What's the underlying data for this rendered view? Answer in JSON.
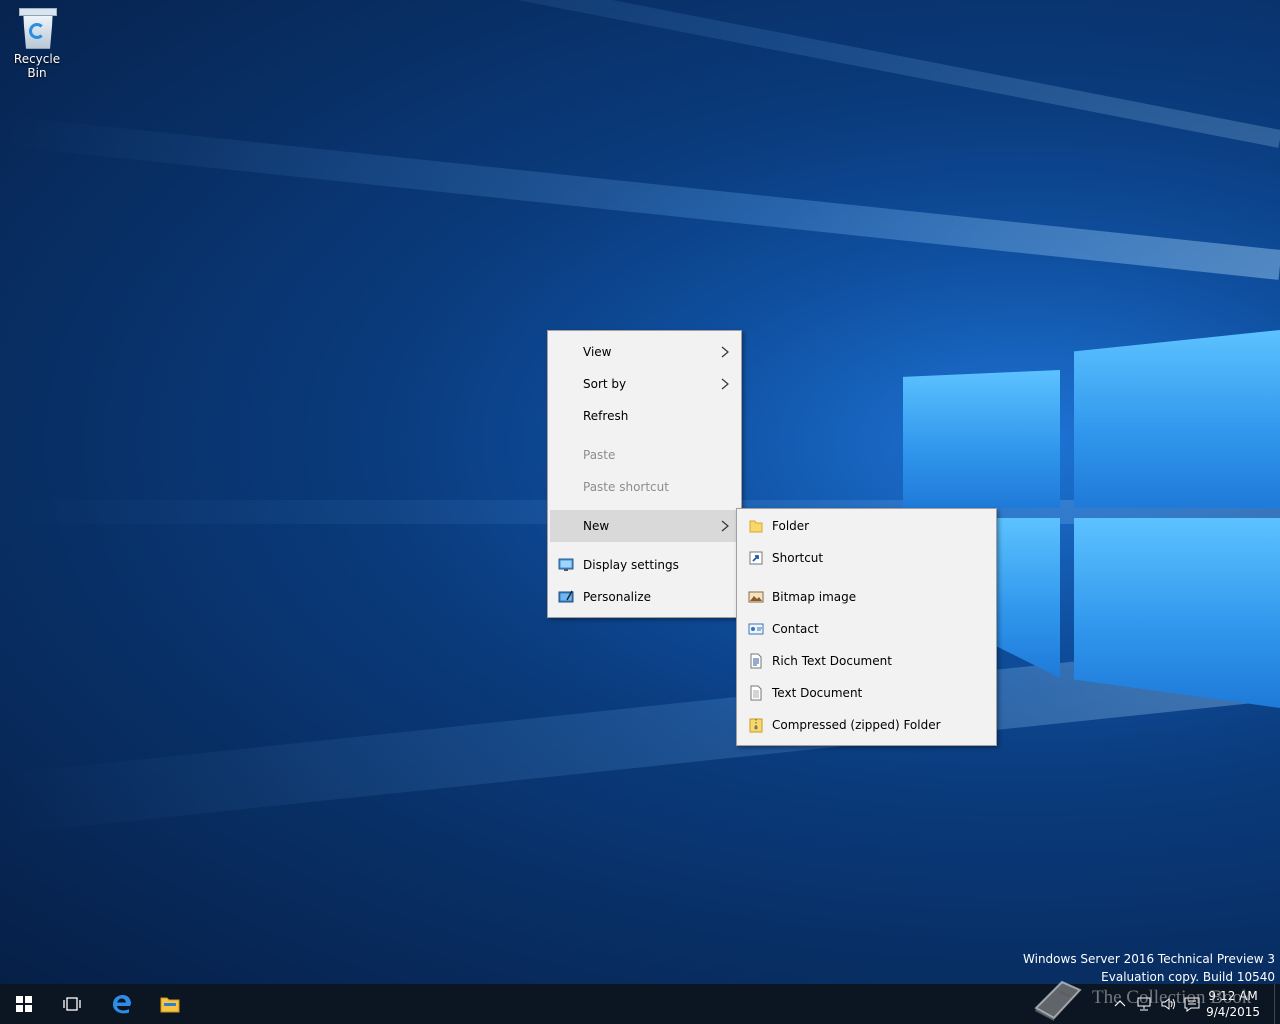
{
  "desktop": {
    "icons": [
      {
        "label": "Recycle Bin",
        "icon": "recycle-bin-icon"
      }
    ]
  },
  "context_menu": {
    "items": [
      {
        "label": "View",
        "submenu": true,
        "enabled": true
      },
      {
        "label": "Sort by",
        "submenu": true,
        "enabled": true
      },
      {
        "label": "Refresh",
        "submenu": false,
        "enabled": true
      },
      {
        "label": "Paste",
        "submenu": false,
        "enabled": false
      },
      {
        "label": "Paste shortcut",
        "submenu": false,
        "enabled": false
      },
      {
        "label": "New",
        "submenu": true,
        "enabled": true,
        "highlighted": true
      },
      {
        "label": "Display settings",
        "submenu": false,
        "enabled": true,
        "icon": "display-icon"
      },
      {
        "label": "Personalize",
        "submenu": false,
        "enabled": true,
        "icon": "personalize-icon"
      }
    ]
  },
  "new_submenu": {
    "items": [
      {
        "label": "Folder",
        "icon": "folder-icon"
      },
      {
        "label": "Shortcut",
        "icon": "shortcut-icon"
      },
      {
        "label": "Bitmap image",
        "icon": "bitmap-icon"
      },
      {
        "label": "Contact",
        "icon": "contact-icon"
      },
      {
        "label": "Rich Text Document",
        "icon": "rich-text-icon"
      },
      {
        "label": "Text Document",
        "icon": "text-document-icon"
      },
      {
        "label": "Compressed (zipped) Folder",
        "icon": "zip-folder-icon"
      }
    ]
  },
  "watermark": {
    "line1": "Windows Server 2016 Technical Preview 3",
    "line2": "Evaluation copy. Build 10540"
  },
  "taskbar": {
    "buttons": [
      "start-icon",
      "task-view-icon",
      "edge-icon",
      "file-explorer-icon"
    ],
    "clock": {
      "time": "9:12 AM",
      "date": "9/4/2015"
    },
    "tray_icons": [
      "chevron-up-icon",
      "network-icon",
      "volume-icon",
      "action-center-icon"
    ]
  },
  "overlay": {
    "brand": "The Collection Book"
  },
  "colors": {
    "menu_bg": "#f2f2f2",
    "menu_highlight": "#d9d9d9",
    "taskbar_bg": "#0c1522",
    "accent_blue": "#2a8ee0"
  }
}
